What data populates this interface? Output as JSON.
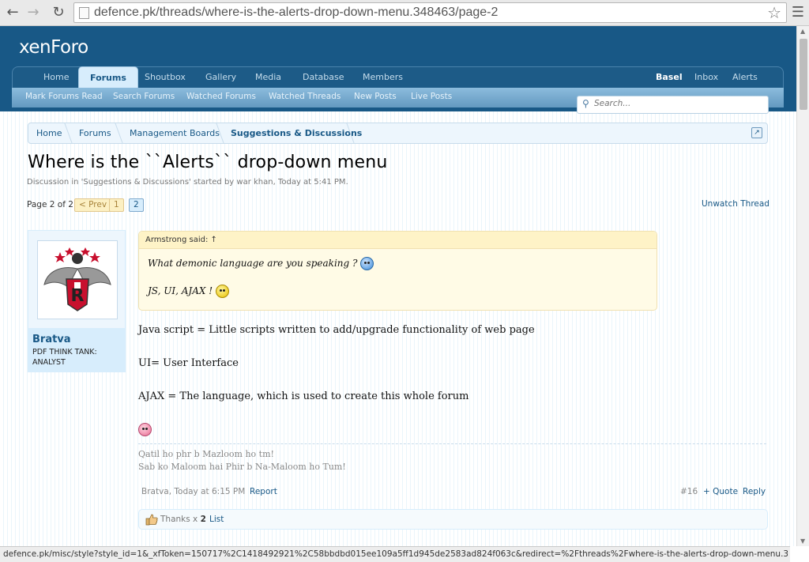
{
  "browser": {
    "url": "defence.pk/threads/where-is-the-alerts-drop-down-menu.348463/page-2",
    "status_url": "defence.pk/misc/style?style_id=1&_xfToken=150717%2C1418492921%2C58bbdbd015ee109a5ff1d945de2583ad824f063c&redirect=%2Fthreads%2Fwhere-is-the-alerts-drop-down-menu.348463%2Fp..."
  },
  "header": {
    "logo": "xenForo",
    "tabs": [
      "Home",
      "Forums",
      "Shoutbox",
      "Gallery",
      "Media",
      "Database",
      "Members"
    ],
    "user_tabs": [
      "Basel",
      "Inbox",
      "Alerts"
    ],
    "subnav": [
      "Mark Forums Read",
      "Search Forums",
      "Watched Forums",
      "Watched Threads",
      "New Posts",
      "Live Posts"
    ],
    "search_placeholder": "Search..."
  },
  "breadcrumb": [
    "Home",
    "Forums",
    "Management Boards",
    "Suggestions & Discussions"
  ],
  "thread": {
    "title": "Where is the ``Alerts`` drop-down menu",
    "meta": "Discussion in 'Suggestions & Discussions' started by war khan, Today at 5:41 PM.",
    "unwatch": "Unwatch Thread"
  },
  "pagenav": {
    "label": "Page 2 of 2",
    "prev": "< Prev",
    "pages": [
      "1",
      "2"
    ],
    "current": "2"
  },
  "post": {
    "username": "Bratva",
    "user_title": "PDF THINK TANK: ANALYST",
    "quote_author": "Armstrong said: ↑",
    "quote_line1": "What demonic language are you speaking ?",
    "quote_line2": "JS, UI, AJAX !",
    "body": [
      "Java script = Little scripts written to add/upgrade functionality of web page",
      "UI= User Interface",
      "AJAX = The language, which is used to create this whole forum"
    ],
    "signature": [
      "Qatil ho phr b Mazloom ho tm!",
      "Sab ko Maloom hai Phir b Na-Maloom ho Tum!"
    ],
    "author_date": "Bratva, Today at 6:15 PM",
    "report": "Report",
    "post_number": "#16",
    "quote_label": "+ Quote",
    "reply_label": "Reply",
    "thanks_label": "Thanks x",
    "thanks_count": "2",
    "list_label": "List"
  },
  "colors": {
    "header_bg": "#185886",
    "link": "#185886",
    "active_tab_bg": "#d7edfc",
    "quote_bg": "#fffbe6"
  },
  "icons": {
    "back": "arrow-left",
    "forward": "arrow-right",
    "reload": "reload",
    "star": "star-outline",
    "menu": "hamburger",
    "search": "magnifier",
    "jump": "external-link",
    "thanks": "thumbs-up"
  }
}
